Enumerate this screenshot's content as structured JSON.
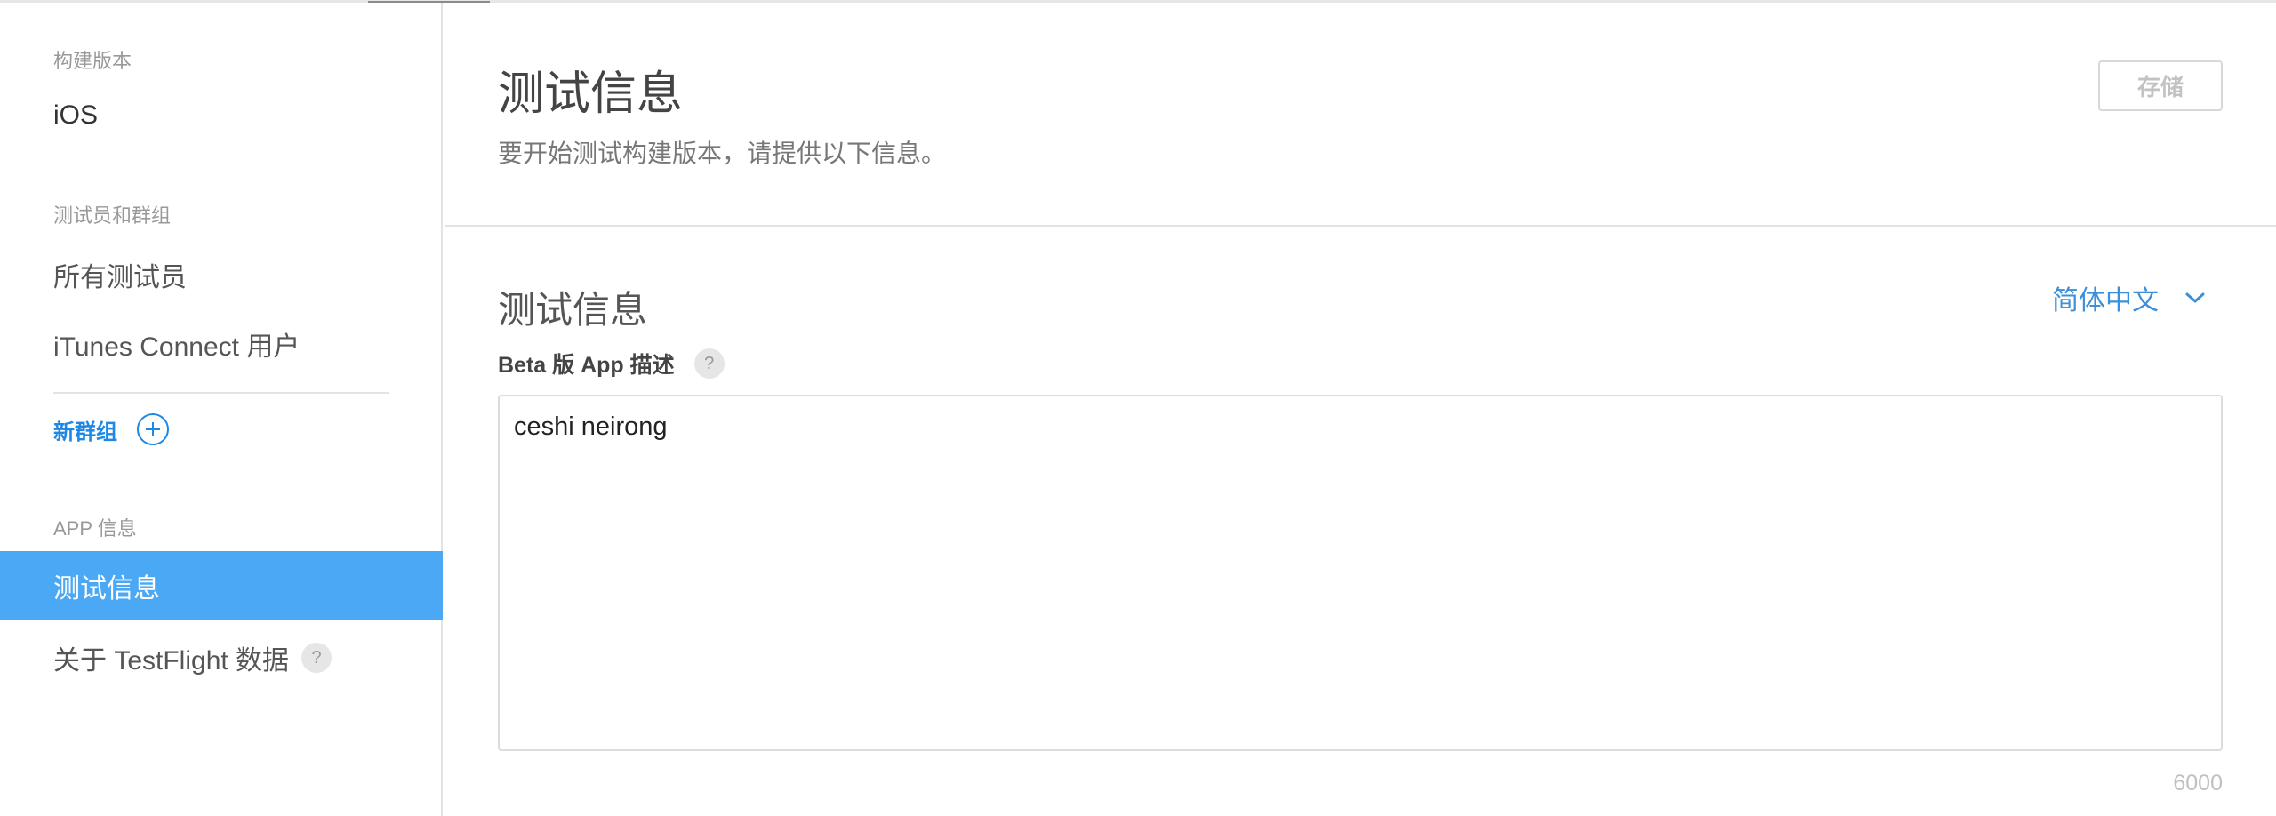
{
  "sidebar": {
    "section_builds": "构建版本",
    "item_ios": "iOS",
    "section_testers": "测试员和群组",
    "item_all_testers": "所有测试员",
    "item_itunes_users": "iTunes Connect 用户",
    "new_group_label": "新群组",
    "section_app_info": "APP 信息",
    "item_test_info_active": "测试信息",
    "item_about_testflight": "关于 TestFlight 数据",
    "help_symbol": "?"
  },
  "main": {
    "page_title": "测试信息",
    "page_subtitle": "要开始测试构建版本，请提供以下信息。",
    "save_label": "存储",
    "section_title": "测试信息",
    "language_selected": "简体中文",
    "field_label": "Beta 版 App 描述",
    "help_symbol": "?",
    "description_value": "ceshi neirong",
    "char_count": "6000"
  },
  "colors": {
    "accent": "#1e88e5",
    "active_bg": "#4aa8f5",
    "link": "#3c8fd8"
  },
  "icons": [
    "plus-circle-icon",
    "help-icon",
    "chevron-down-icon"
  ]
}
